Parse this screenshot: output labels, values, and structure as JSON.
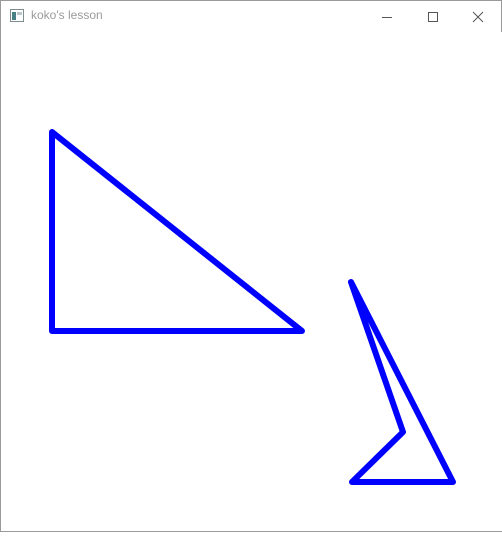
{
  "window": {
    "title": "koko's lesson"
  },
  "titlebar": {
    "icons": [
      "app-icon",
      "minimize-icon",
      "maximize-icon",
      "close-icon"
    ]
  },
  "canvas": {
    "background": "#ffffff",
    "stroke_color": "#0000ff",
    "shapes": [
      {
        "type": "triangle",
        "name": "right-triangle"
      },
      {
        "type": "polygon",
        "name": "arrow-shape"
      }
    ]
  }
}
